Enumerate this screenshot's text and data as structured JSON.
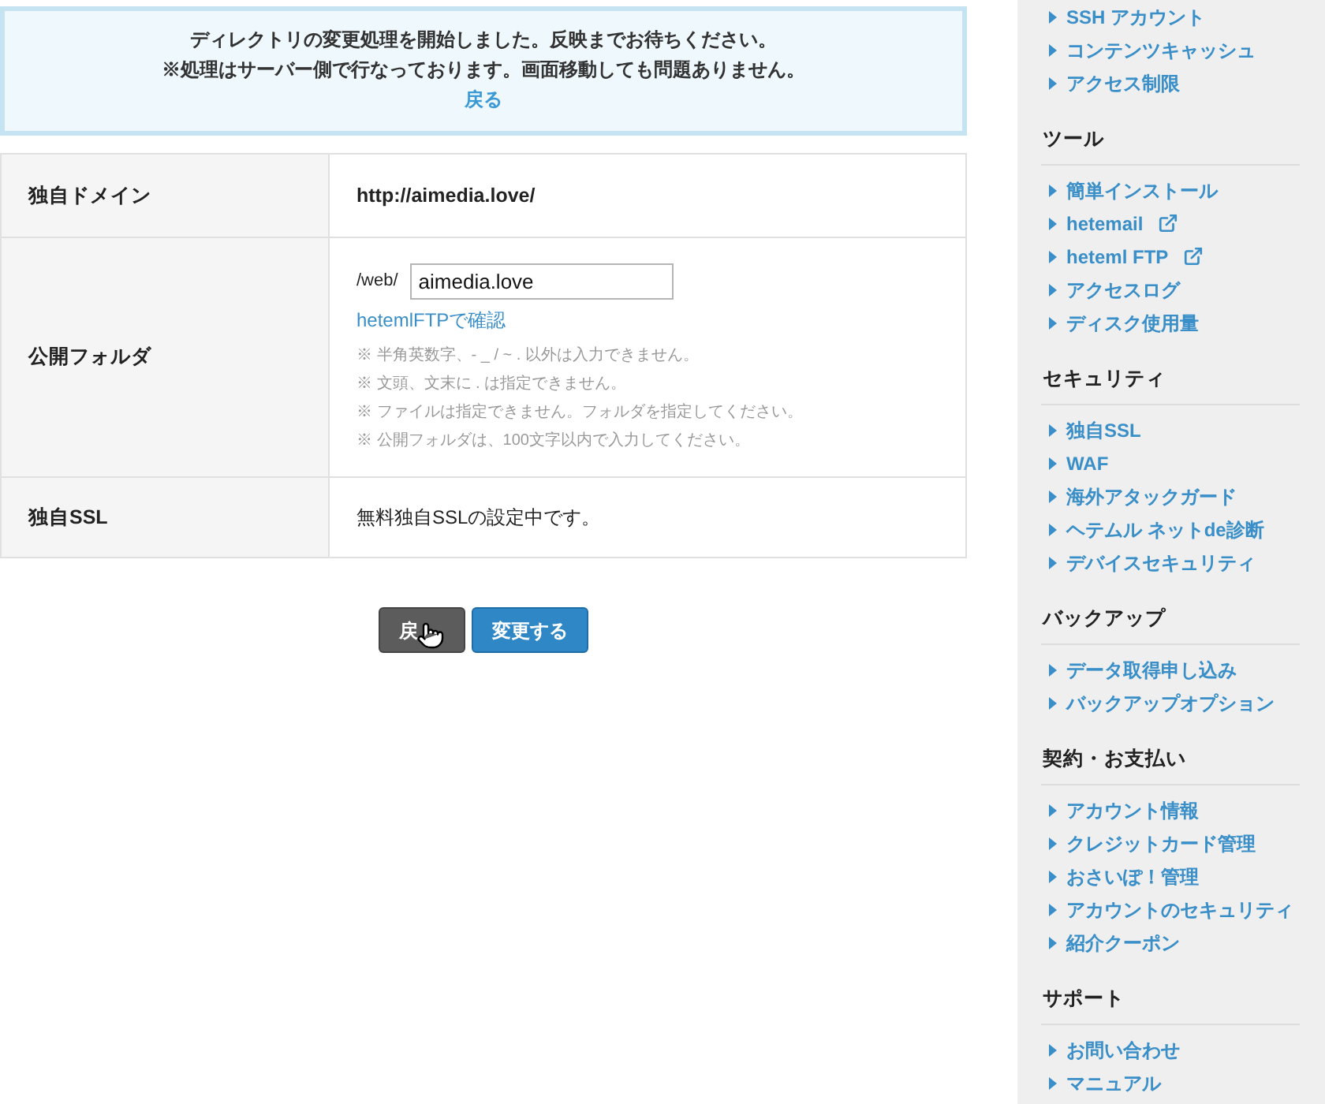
{
  "notice": {
    "lines": [
      "ディレクトリの変更処理を開始しました。反映までお待ちください。",
      "※処理はサーバー側で行なっております。画面移動しても問題ありません。"
    ],
    "link": "戻る"
  },
  "settings_table": {
    "rows": [
      {
        "kind": "domain",
        "label": "独自ドメイン",
        "value": "http://aimedia.love/"
      },
      {
        "kind": "folder",
        "label": "公開フォルダ",
        "prefix": "/web/",
        "input_value": "aimedia.love",
        "link": "hetemlFTPで確認",
        "notes": [
          "※ 半角英数字、- _ / ~ . 以外は入力できません。",
          "※ 文頭、文末に . は指定できません。",
          "※ ファイルは指定できません。フォルダを指定してください。",
          "※ 公開フォルダは、100文字以内で入力してください。"
        ]
      },
      {
        "kind": "status",
        "label": "独自SSL",
        "value": "無料独自SSLの設定中です。"
      }
    ]
  },
  "buttons": [
    {
      "kind": "back",
      "label": "戻",
      "hovered": true
    },
    {
      "kind": "submit",
      "label": "変更する",
      "hovered": false
    }
  ],
  "sidebar": {
    "sections": [
      {
        "items": [
          {
            "label": "SSH アカウント"
          },
          {
            "label": "コンテンツキャッシュ"
          },
          {
            "label": "アクセス制限"
          }
        ]
      },
      {
        "heading": "ツール",
        "items": [
          {
            "label": "簡単インストール",
            "external": false
          },
          {
            "label": "hetemail",
            "external": true
          },
          {
            "label": "heteml FTP",
            "external": true
          },
          {
            "label": "アクセスログ",
            "external": false
          },
          {
            "label": "ディスク使用量",
            "external": false
          }
        ]
      },
      {
        "heading": "セキュリティ",
        "items": [
          {
            "label": "独自SSL"
          },
          {
            "label": "WAF"
          },
          {
            "label": "海外アタックガード"
          },
          {
            "label": "ヘテムル ネットde診断"
          },
          {
            "label": "デバイスセキュリティ"
          }
        ]
      },
      {
        "heading": "バックアップ",
        "items": [
          {
            "label": "データ取得申し込み"
          },
          {
            "label": "バックアップオプション"
          }
        ]
      },
      {
        "heading": "契約・お支払い",
        "items": [
          {
            "label": "アカウント情報"
          },
          {
            "label": "クレジットカード管理"
          },
          {
            "label": "おさいぽ！管理"
          },
          {
            "label": "アカウントのセキュリティ"
          },
          {
            "label": "紹介クーポン"
          }
        ]
      },
      {
        "heading": "サポート",
        "items": [
          {
            "label": "お問い合わせ"
          },
          {
            "label": "マニュアル"
          }
        ]
      }
    ]
  }
}
